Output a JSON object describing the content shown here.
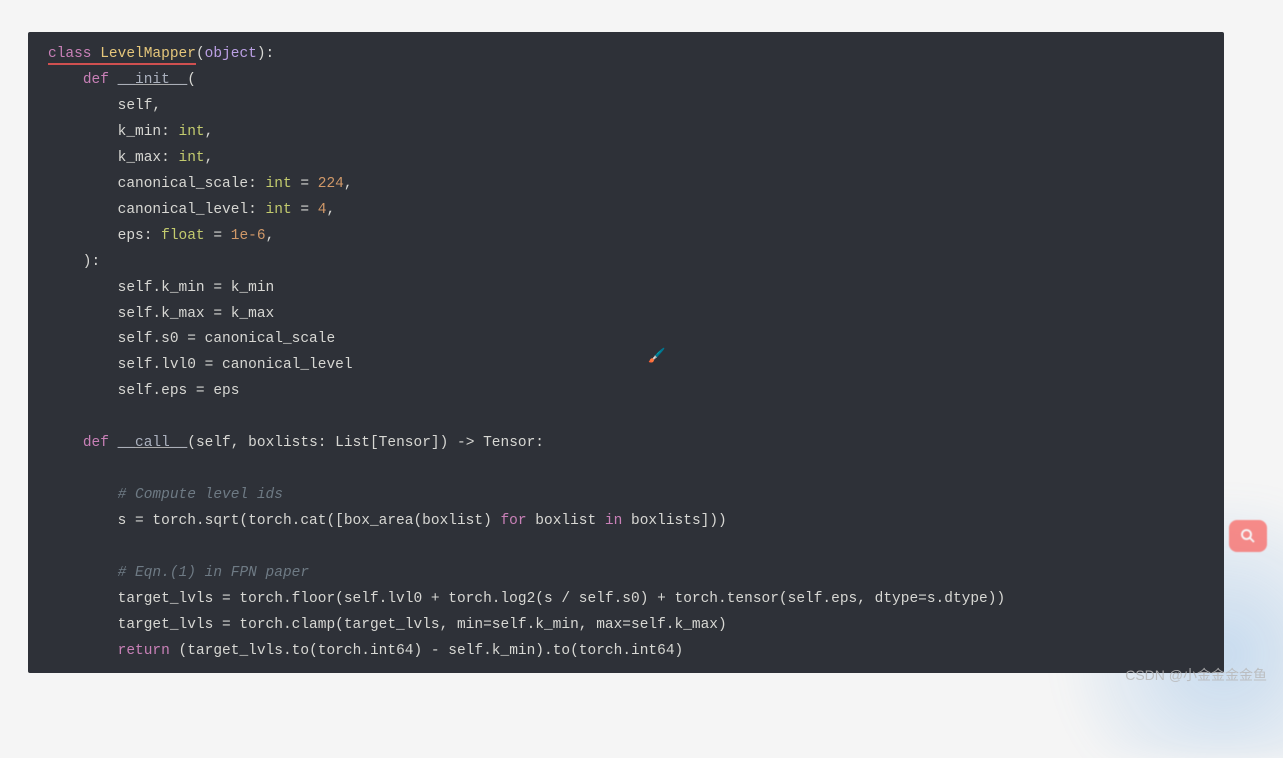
{
  "code": {
    "l1a": "class ",
    "l1b": "LevelMapper",
    "l1c": "(",
    "l1d": "object",
    "l1e": "):",
    "l2a": "    ",
    "l2b": "def",
    "l2c": " ",
    "l2d": "__init__",
    "l2e": "(",
    "l3": "        self,",
    "l4a": "        k_min: ",
    "l4b": "int",
    "l4c": ",",
    "l5a": "        k_max: ",
    "l5b": "int",
    "l5c": ",",
    "l6a": "        canonical_scale: ",
    "l6b": "int",
    "l6c": " = ",
    "l6d": "224",
    "l6e": ",",
    "l7a": "        canonical_level: ",
    "l7b": "int",
    "l7c": " = ",
    "l7d": "4",
    "l7e": ",",
    "l8a": "        eps: ",
    "l8b": "float",
    "l8c": " = ",
    "l8d": "1e-6",
    "l8e": ",",
    "l9": "    ):",
    "l10": "        self.k_min = k_min",
    "l11": "        self.k_max = k_max",
    "l12": "        self.s0 = canonical_scale",
    "l13": "        self.lvl0 = canonical_level",
    "l14": "        self.eps = eps",
    "l15": "",
    "l16a": "    ",
    "l16b": "def",
    "l16c": " ",
    "l16d": "__call__",
    "l16e": "(self, boxlists: List[Tensor]) -> Tensor:",
    "l17": "",
    "l18a": "        ",
    "l18b": "# Compute level ids",
    "l19a": "        s = torch.sqrt(torch.cat([box_area(boxlist) ",
    "l19b": "for",
    "l19c": " boxlist ",
    "l19d": "in",
    "l19e": " boxlists]))",
    "l20": "",
    "l21a": "        ",
    "l21b": "# Eqn.(1) in FPN paper",
    "l22": "        target_lvls = torch.floor(self.lvl0 + torch.log2(s / self.s0) + torch.tensor(self.eps, dtype=s.dtype))",
    "l23": "        target_lvls = torch.clamp(target_lvls, min=self.k_min, max=self.k_max)",
    "l24a": "        ",
    "l24b": "return",
    "l24c": " (target_lvls.to(torch.int64) - self.k_min).to(torch.int64)"
  },
  "watermark": "CSDN @小金金金金鱼",
  "cursor_glyph": "🖌️"
}
